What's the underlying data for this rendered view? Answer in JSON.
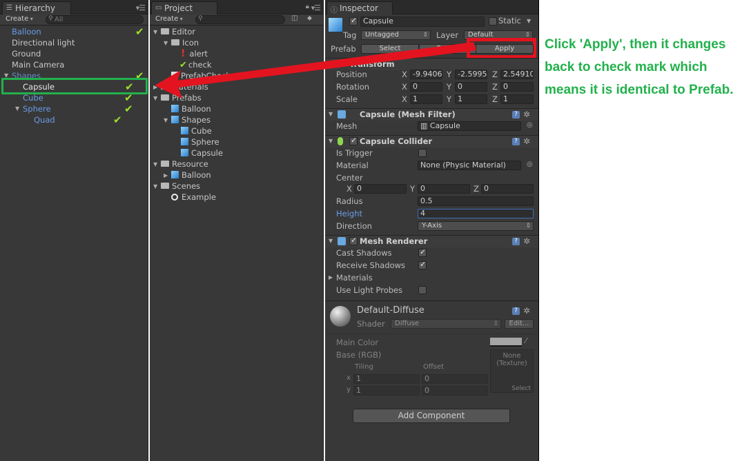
{
  "hierarchy": {
    "tab": "Hierarchy",
    "create": "Create",
    "search_placeholder": "All",
    "items": [
      "Balloon",
      "Directional light",
      "Ground",
      "Main Camera",
      "Shapes",
      "Capsule",
      "Cube",
      "Sphere",
      "Quad"
    ]
  },
  "project": {
    "tab": "Project",
    "create": "Create",
    "items": [
      "Editor",
      "Icon",
      "alert",
      "check",
      "PrefabCheck",
      "Materials",
      "Prefabs",
      "Balloon",
      "Shapes",
      "Cube",
      "Sphere",
      "Capsule",
      "Resource",
      "Balloon",
      "Scenes",
      "Example"
    ]
  },
  "inspector": {
    "tab": "Inspector",
    "object_name": "Capsule",
    "static_label": "Static",
    "tag_label": "Tag",
    "tag_value": "Untagged",
    "layer_label": "Layer",
    "layer_value": "Default",
    "prefab_label": "Prefab",
    "select_btn": "Select",
    "revert_btn": "Revert",
    "apply_btn": "Apply",
    "transform": {
      "title": "Transform",
      "position_label": "Position",
      "px": "-9.9406",
      "py": "-2.5995",
      "pz": "2.54910",
      "rotation_label": "Rotation",
      "rx": "0",
      "ry": "0",
      "rz": "0",
      "scale_label": "Scale",
      "sx": "1",
      "sy": "1",
      "sz": "1"
    },
    "mesh_filter": {
      "title": "Capsule (Mesh Filter)",
      "mesh_label": "Mesh",
      "mesh_value": "Capsule"
    },
    "collider": {
      "title": "Capsule Collider",
      "is_trigger": "Is Trigger",
      "material_label": "Material",
      "material_value": "None (Physic Material)",
      "center_label": "Center",
      "cx": "0",
      "cy": "0",
      "cz": "0",
      "radius_label": "Radius",
      "radius_value": "0.5",
      "height_label": "Height",
      "height_value": "4",
      "direction_label": "Direction",
      "direction_value": "Y-Axis"
    },
    "renderer": {
      "title": "Mesh Renderer",
      "cast": "Cast Shadows",
      "receive": "Receive Shadows",
      "materials": "Materials",
      "probes": "Use Light Probes"
    },
    "material": {
      "name": "Default-Diffuse",
      "shader_label": "Shader",
      "shader_value": "Diffuse",
      "edit": "Edit...",
      "main_color": "Main Color",
      "base": "Base (RGB)",
      "tiling": "Tiling",
      "offset": "Offset",
      "x_label": "x",
      "y_label": "y",
      "tx": "1",
      "ox": "0",
      "ty": "1",
      "oy": "0",
      "texture_none": "None",
      "texture_label": "(Texture)",
      "select": "Select"
    },
    "add_component": "Add Component"
  },
  "annotation": {
    "line1": "Click 'Apply', then it changes",
    "line2": "back to check mark which",
    "line3": "means it is identical to Prefab."
  },
  "colors": {
    "highlight_green": "#22b14c",
    "highlight_red": "#e3141f",
    "check_green": "#9be12b",
    "prefab_blue": "#6a9de8"
  }
}
